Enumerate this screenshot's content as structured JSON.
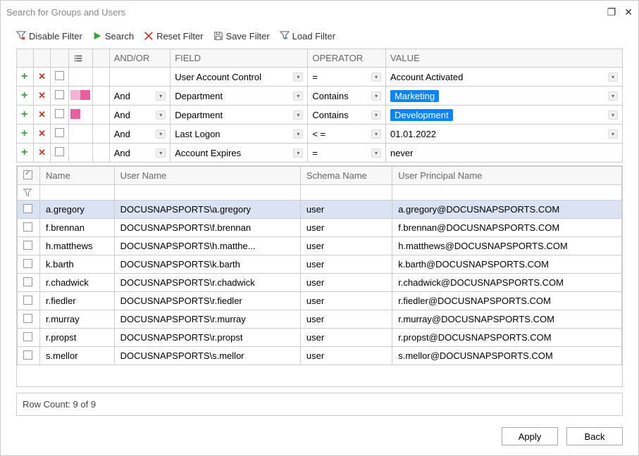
{
  "title": "Search for Groups and Users",
  "toolbar": {
    "disable_filter": "Disable Filter",
    "search": "Search",
    "reset_filter": "Reset Filter",
    "save_filter": "Save Filter",
    "load_filter": "Load Filter"
  },
  "filter_headers": {
    "andor": "AND/OR",
    "field": "FIELD",
    "operator": "OPERATOR",
    "value": "VALUE"
  },
  "filter_rows": [
    {
      "andor": "",
      "field": "User Account Control",
      "operator": "=",
      "value": "Account Activated",
      "pill": false,
      "pink": 0
    },
    {
      "andor": "And",
      "field": "Department",
      "operator": "Contains",
      "value": "Marketing",
      "pill": true,
      "pink": 2
    },
    {
      "andor": "And",
      "field": "Department",
      "operator": "Contains",
      "value": "Development",
      "pill": true,
      "pink": 1
    },
    {
      "andor": "And",
      "field": "Last Logon",
      "operator": "< =",
      "value": "01.01.2022",
      "pill": false,
      "pink": 0
    },
    {
      "andor": "And",
      "field": "Account Expires",
      "operator": "=",
      "value": "never",
      "pill": false,
      "pink": 0
    }
  ],
  "results_headers": {
    "name": "Name",
    "username": "User Name",
    "schema": "Schema Name",
    "upn": "User Principal Name"
  },
  "results_rows": [
    {
      "name": "a.gregory",
      "username": "DOCUSNAPSPORTS\\a.gregory",
      "schema": "user",
      "upn": "a.gregory@DOCUSNAPSPORTS.COM"
    },
    {
      "name": "f.brennan",
      "username": "DOCUSNAPSPORTS\\f.brennan",
      "schema": "user",
      "upn": "f.brennan@DOCUSNAPSPORTS.COM"
    },
    {
      "name": "h.matthews",
      "username": "DOCUSNAPSPORTS\\h.matthe...",
      "schema": "user",
      "upn": "h.matthews@DOCUSNAPSPORTS.COM"
    },
    {
      "name": "k.barth",
      "username": "DOCUSNAPSPORTS\\k.barth",
      "schema": "user",
      "upn": "k.barth@DOCUSNAPSPORTS.COM"
    },
    {
      "name": "r.chadwick",
      "username": "DOCUSNAPSPORTS\\r.chadwick",
      "schema": "user",
      "upn": "r.chadwick@DOCUSNAPSPORTS.COM"
    },
    {
      "name": "r.fiedler",
      "username": "DOCUSNAPSPORTS\\r.fiedler",
      "schema": "user",
      "upn": "r.fiedler@DOCUSNAPSPORTS.COM"
    },
    {
      "name": "r.murray",
      "username": "DOCUSNAPSPORTS\\r.murray",
      "schema": "user",
      "upn": "r.murray@DOCUSNAPSPORTS.COM"
    },
    {
      "name": "r.propst",
      "username": "DOCUSNAPSPORTS\\r.propst",
      "schema": "user",
      "upn": "r.propst@DOCUSNAPSPORTS.COM"
    },
    {
      "name": "s.mellor",
      "username": "DOCUSNAPSPORTS\\s.mellor",
      "schema": "user",
      "upn": "s.mellor@DOCUSNAPSPORTS.COM"
    }
  ],
  "status": "Row Count: 9 of 9",
  "footer": {
    "apply": "Apply",
    "back": "Back"
  }
}
